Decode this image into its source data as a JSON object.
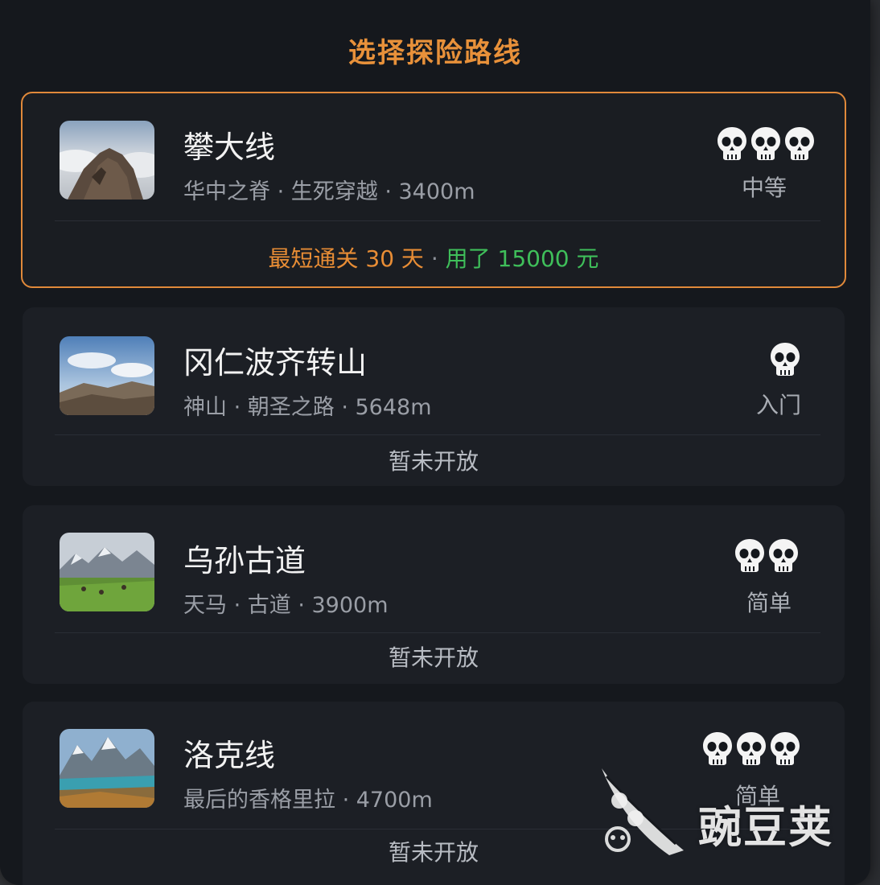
{
  "screen": {
    "title": "选择探险路线"
  },
  "routes": [
    {
      "name": "攀大线",
      "subtitle": "华中之脊 · 生死穿越 · 3400m",
      "skulls": 3,
      "difficulty": "中等",
      "selected": true,
      "footer": {
        "best": "最短通关 30 天",
        "separator": "·",
        "cost": "用了 15000 元"
      },
      "thumbnail": "mountain-rock-clouds"
    },
    {
      "name": "冈仁波齐转山",
      "subtitle": "神山 · 朝圣之路 · 5648m",
      "skulls": 1,
      "difficulty": "入门",
      "selected": false,
      "status": "暂未开放",
      "thumbnail": "sky-and-hills"
    },
    {
      "name": "乌孙古道",
      "subtitle": "天马 · 古道 · 3900m",
      "skulls": 2,
      "difficulty": "简单",
      "selected": false,
      "status": "暂未开放",
      "thumbnail": "green-meadow-mountains"
    },
    {
      "name": "洛克线",
      "subtitle": "最后的香格里拉 · 4700m",
      "skulls": 3,
      "difficulty": "简单",
      "selected": false,
      "status": "暂未开放",
      "thumbnail": "lake-and-peaks"
    }
  ],
  "watermark": {
    "text": "豌豆荚",
    "icon": "pea-pod-logo"
  },
  "colors": {
    "accent": "#e88d35",
    "cost_green": "#3fbf5a",
    "panel": "#15181d",
    "card": "#1c1f25"
  }
}
